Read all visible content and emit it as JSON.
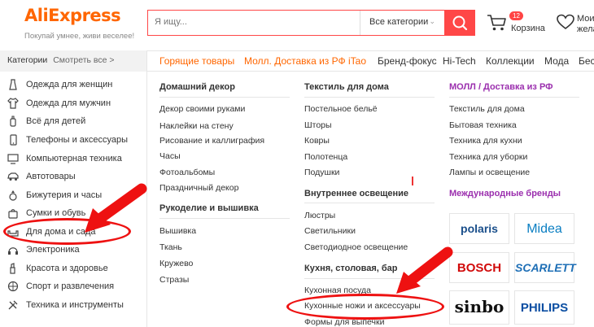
{
  "header": {
    "logo": "AliExpress",
    "tagline": "Покупай умнее, живи веселее!",
    "search_placeholder": "Я ищу...",
    "search_category": "Все категории",
    "cart_count": "12",
    "cart_label": "Корзина",
    "wishlist_label_1": "Мои",
    "wishlist_label_2": "жела"
  },
  "nav": {
    "categories_label": "Категории",
    "see_all": "Смотреть все >",
    "items": [
      "Горящие товары",
      "Молл. Доставка из РФ",
      "iTao",
      "Бренд-фокус",
      "Hi-Tech",
      "Коллекции",
      "Мода",
      "Бест"
    ]
  },
  "sidebar": {
    "items": [
      {
        "label": "Одежда для женщин",
        "icon": "dress-icon"
      },
      {
        "label": "Одежда для мужчин",
        "icon": "shirt-icon"
      },
      {
        "label": "Всё для детей",
        "icon": "baby-bottle-icon"
      },
      {
        "label": "Телефоны и аксессуары",
        "icon": "phone-icon"
      },
      {
        "label": "Компьютерная техника",
        "icon": "monitor-icon"
      },
      {
        "label": "Автотовары",
        "icon": "car-icon"
      },
      {
        "label": "Бижутерия и часы",
        "icon": "ring-icon"
      },
      {
        "label": "Сумки и обувь",
        "icon": "bag-icon"
      },
      {
        "label": "Для дома и сада",
        "icon": "sofa-icon"
      },
      {
        "label": "Электроника",
        "icon": "headphones-icon"
      },
      {
        "label": "Красота и здоровье",
        "icon": "makeup-icon"
      },
      {
        "label": "Спорт и развлечения",
        "icon": "ball-icon"
      },
      {
        "label": "Техника и инструменты",
        "icon": "tools-icon"
      }
    ]
  },
  "menu": {
    "col1": {
      "head1": "Домашний декор",
      "links1": [
        "Декор своими руками",
        "Наклейки на стену",
        "Рисование и каллиграфия",
        "Часы",
        "Фотоальбомы",
        "Праздничный декор"
      ],
      "head2": "Рукоделие и вышивка",
      "links2": [
        "Вышивка",
        "Ткань",
        "Кружево",
        "Стразы"
      ]
    },
    "col2": {
      "head1": "Текстиль для дома",
      "links1": [
        "Постельное бельё",
        "Шторы",
        "Ковры",
        "Полотенца",
        "Подушки"
      ],
      "head2": "Внутреннее освещение",
      "links2": [
        "Люстры",
        "Светильники",
        "Светодиодное освещение"
      ],
      "head3": "Кухня, столовая, бар",
      "links3": [
        "Кухонная посуда",
        "Кухонные ножи и аксессуары",
        "Формы для выпечки"
      ]
    },
    "col3": {
      "head1": "МОЛЛ / Доставка из РФ",
      "links1": [
        "Текстиль для дома",
        "Бытовая техника",
        "Техника для кухни",
        "Техника для уборки",
        "Лампы и освещение"
      ],
      "head2": "Международные бренды",
      "brands": [
        "polaris",
        "Midea",
        "BOSCH",
        "SCARLETT",
        "sinbo",
        "PHILIPS"
      ]
    }
  },
  "colors": {
    "brand_orange": "#ff6600",
    "search_red": "#ff4747",
    "annotation_red": "#ee1111",
    "purple": "#9b2fae"
  }
}
